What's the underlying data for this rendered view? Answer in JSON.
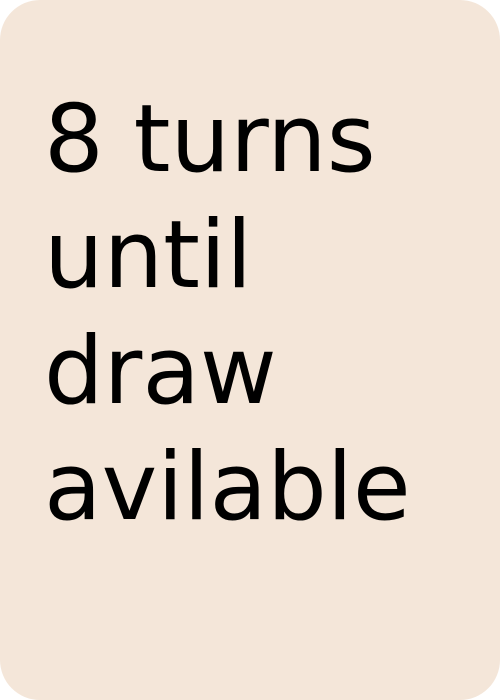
{
  "card": {
    "lines": [
      "8 turns",
      "until",
      "draw",
      "avilable"
    ],
    "background_color": "#f4e6d9",
    "text_color": "#000000"
  }
}
